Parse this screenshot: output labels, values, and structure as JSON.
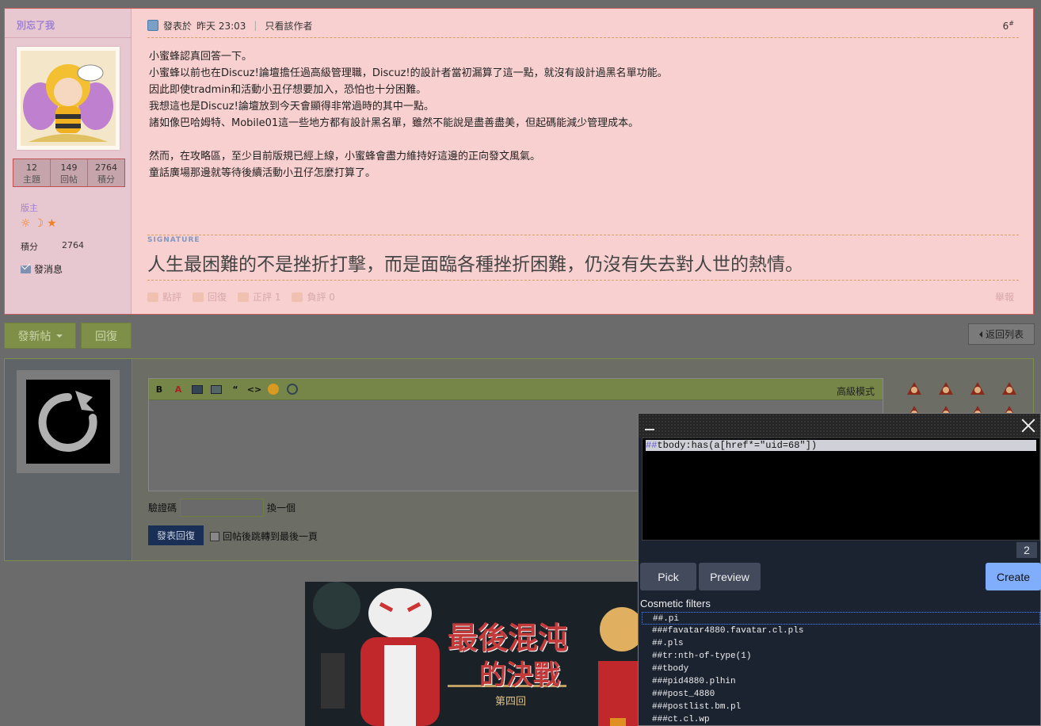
{
  "post": {
    "author": "別忘了我",
    "stats": [
      {
        "value": "12",
        "label": "主題"
      },
      {
        "value": "149",
        "label": "回帖"
      },
      {
        "value": "2764",
        "label": "積分"
      }
    ],
    "rank": "版主",
    "credit_label": "積分",
    "credit_value": "2764",
    "pm_label": "發消息",
    "posted_label": "發表於",
    "posted_time": "昨天 23:03",
    "only_author": "只看該作者",
    "floor": "6",
    "floor_mark": "#",
    "content": [
      "小蜜蜂認真回答一下。",
      "小蜜蜂以前也在Discuz!論壇擔任過高級管理職，Discuz!的設計者當初漏算了這一點，就沒有設計過黑名單功能。",
      "因此即使tradmin和活動小丑仔想要加入，恐怕也十分困難。",
      "我想這也是Discuz!論壇放到今天會顯得非常過時的其中一點。",
      "諸如像巴哈姆特、Mobile01這一些地方都有設計黑名單，雖然不能說是盡善盡美，但起碼能減少管理成本。",
      "",
      "然而，在攻略區，至少目前版規已經上線，小蜜蜂會盡力維持好這邊的正向發文風氣。",
      "童話廣場那邊就等待後續活動小丑仔怎麼打算了。"
    ],
    "signature_label": "SIGNATURE",
    "signature": "人生最困難的不是挫折打擊，而是面臨各種挫折困難，仍沒有失去對人世的熱情。",
    "actions": {
      "rate": "點評",
      "reply": "回復",
      "support": "正評 1",
      "oppose": "負評 0"
    },
    "report": "舉報"
  },
  "toolbar": {
    "new_thread": "發新帖",
    "reply": "回復",
    "back_to_list": "返回列表"
  },
  "reply_form": {
    "advanced_mode": "高級模式",
    "captcha_label": "驗證碼",
    "captcha_refresh": "換一個",
    "submit": "發表回復",
    "jump_label": "回帖後跳轉到最後一頁"
  },
  "banner": {
    "title_line1": "最後混沌",
    "title_line2": "的決戰",
    "subtitle": "第四回"
  },
  "picker": {
    "filter_hash": "##",
    "filter_text": "tbody:has(a[href*=\"uid=68\"])",
    "match_count": "2",
    "pick": "Pick",
    "preview": "Preview",
    "create": "Create",
    "section_title": "Cosmetic filters",
    "filters": [
      "##.pi",
      "###favatar4880.favatar.cl.pls",
      "##.pls",
      "##tr:nth-of-type(1)",
      "##tbody",
      "###pid4880.plhin",
      "###post_4880",
      "###postlist.bm.pl",
      "###ct.cl.wp"
    ]
  },
  "colors": {
    "highlight_bg": "#f8d0d0",
    "highlight_border": "#c86060",
    "forum_green": "#7e8f48",
    "picker_accent": "#80aefc"
  }
}
